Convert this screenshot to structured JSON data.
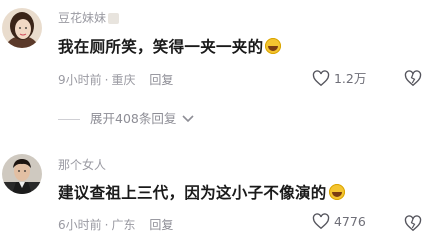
{
  "comments": [
    {
      "username": "豆花妹妹",
      "content": "我在厕所笑，笑得一夹一夹的",
      "emoji_icon": "rolling-on-floor-laughing-emoji",
      "time": "9小时前",
      "location": "重庆",
      "reply_label": "回复",
      "like_count": "1.2万"
    },
    {
      "username": "那个女人",
      "content": "建议查祖上三代，因为这小子不像演的",
      "emoji_icon": "tears-of-joy-emoji",
      "time": "6小时前",
      "location": "广东",
      "reply_label": "回复",
      "like_count": "4776"
    }
  ],
  "expand_replies": "展开408条回复",
  "separator": "·",
  "colors": {
    "meta_text": "#9a9aa2",
    "content_text": "#1a1a1a",
    "background": "#ffffff"
  }
}
